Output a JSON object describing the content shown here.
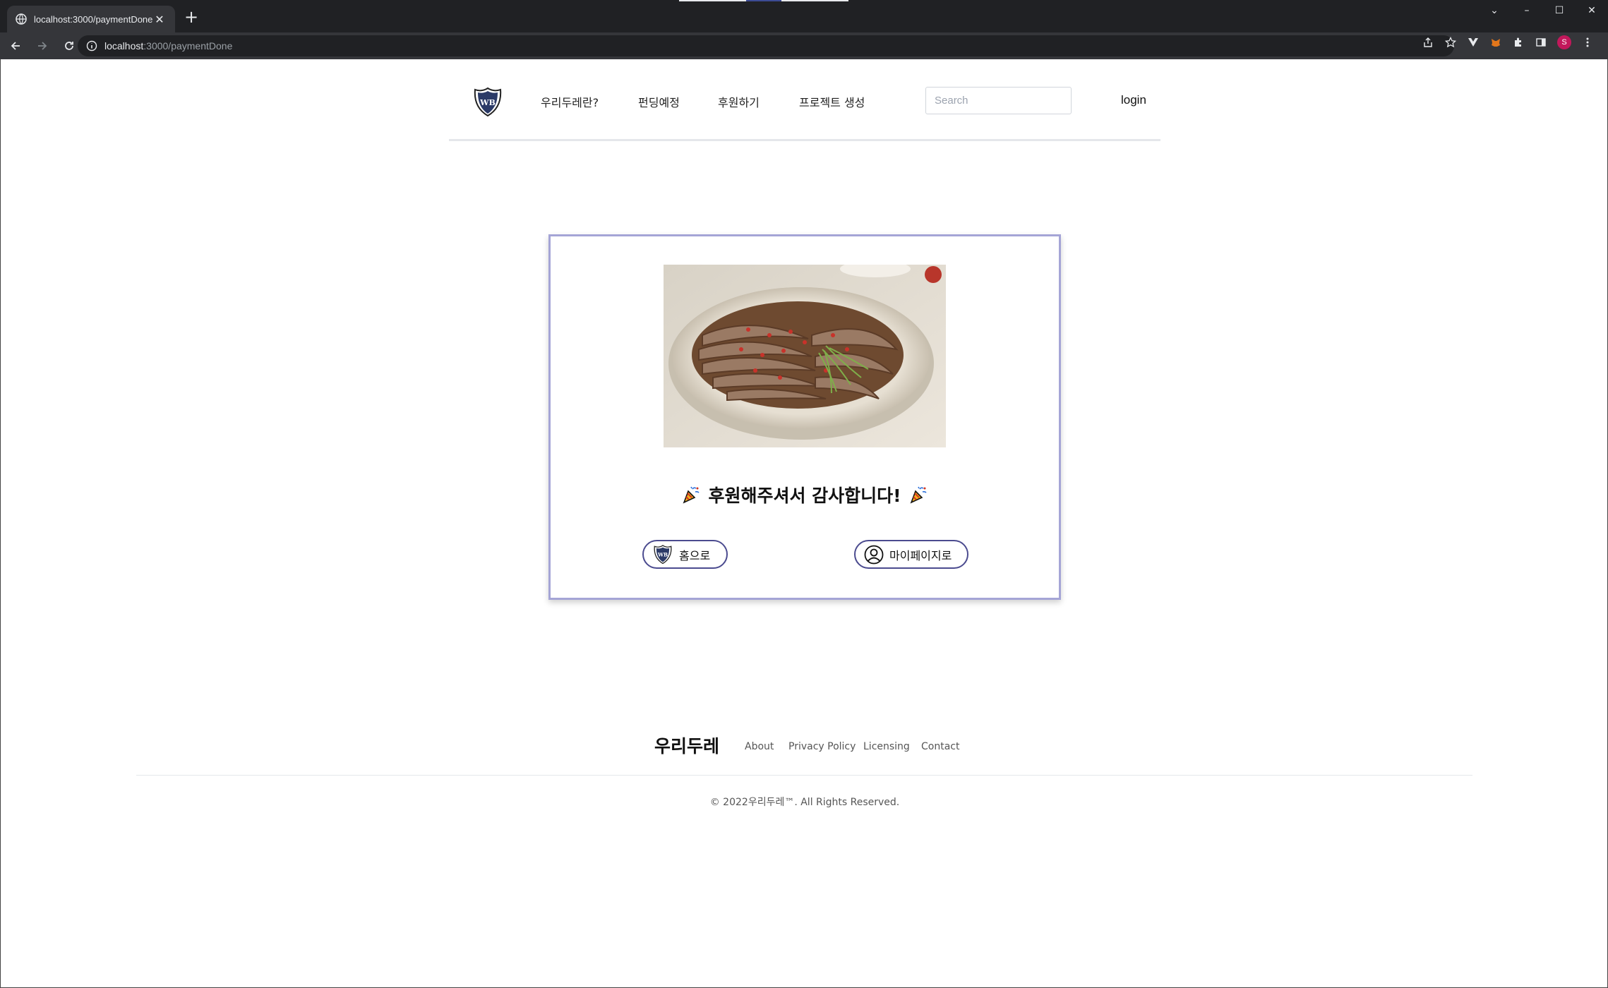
{
  "browser": {
    "tab_title": "localhost:3000/paymentDone",
    "url_host": "localhost",
    "url_path": ":3000/paymentDone",
    "profile_initial": "S",
    "accent_colors": [
      "#e8eaed",
      "#3c4b94",
      "#e8eaed"
    ]
  },
  "header": {
    "nav": [
      "우리두레란?",
      "펀딩예정",
      "후원하기",
      "프로젝트 생성"
    ],
    "search_placeholder": "Search",
    "login_label": "login"
  },
  "card": {
    "message": "후원해주셔서 감사합니다!",
    "home_button": "홈으로",
    "mypage_button": "마이페이지로",
    "border_color": "#a5a5d6",
    "button_border_color": "#4b4b8f"
  },
  "footer": {
    "brand": "우리두레",
    "links": [
      "About",
      "Privacy Policy",
      "Licensing",
      "Contact"
    ],
    "copyright": "© 2022우리두레™. All Rights Reserved."
  }
}
